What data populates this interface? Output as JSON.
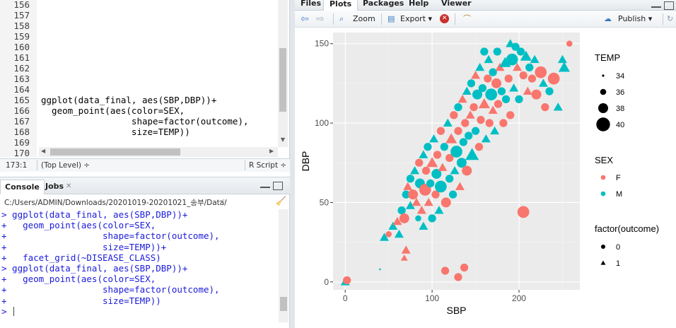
{
  "editor": {
    "line_numbers": [
      "156",
      "157",
      "158",
      "159",
      "160",
      "161",
      "162",
      "163",
      "164",
      "165",
      "166",
      "167",
      "168",
      "169",
      "170"
    ],
    "code_lines": [
      {
        "line": 165,
        "text": "ggplot(data_final, aes(SBP,DBP))+"
      },
      {
        "line": 166,
        "text": "  geom_point(aes(color=SEX,"
      },
      {
        "line": 167,
        "text": "                 shape=factor(outcome),"
      },
      {
        "line": 168,
        "text": "                 size=TEMP))"
      }
    ],
    "status": {
      "position": "173:1",
      "scope": "(Top Level) ÷",
      "filetype": "R Script ÷"
    }
  },
  "console": {
    "tabs": [
      {
        "label": "Console"
      },
      {
        "label": "Jobs"
      }
    ],
    "path": "C:/Users/ADMIN/Downloads/20201019-20201021_송부/Data/",
    "lines": [
      "> ggplot(data_final, aes(SBP,DBP))+",
      "+   geom_point(aes(color=SEX,",
      "+                  shape=factor(outcome),",
      "+                  size=TEMP))+",
      "+   facet_grid(~DISEASE_CLASS)",
      "> ggplot(data_final, aes(SBP,DBP))+",
      "+   geom_point(aes(color=SEX,",
      "+                  shape=factor(outcome),",
      "+                  size=TEMP))",
      "> "
    ]
  },
  "right_pane": {
    "tabs": [
      {
        "label": "Files"
      },
      {
        "label": "Plots"
      },
      {
        "label": "Packages"
      },
      {
        "label": "Help"
      },
      {
        "label": "Viewer"
      }
    ],
    "active_tab": "Plots",
    "toolbar": {
      "zoom": "Zoom",
      "export": "Export ▾",
      "publish": "Publish ▾"
    }
  },
  "chart_data": {
    "type": "scatter",
    "title": "",
    "xlabel": "SBP",
    "ylabel": "DBP",
    "xlim": [
      -14,
      270
    ],
    "ylim": [
      -5,
      157
    ],
    "x_ticks": [
      0,
      100,
      200
    ],
    "y_ticks": [
      0,
      50,
      100,
      150
    ],
    "panel_background": "#ebebeb",
    "grid": true,
    "series": [
      {
        "name": "F",
        "color": "#f8766d"
      },
      {
        "name": "M",
        "color": "#00bfc4"
      }
    ],
    "legend_position": "right",
    "legends": {
      "size": {
        "title": "TEMP",
        "labels": [
          "34",
          "36",
          "38",
          "40"
        ]
      },
      "color": {
        "title": "SEX",
        "labels": [
          "F",
          "M"
        ]
      },
      "shape": {
        "title": "factor(outcome)",
        "labels": [
          "0",
          "1"
        ]
      }
    },
    "points": [
      {
        "x": 0,
        "y": 0,
        "sex": "M",
        "outcome": 1,
        "temp": 37
      },
      {
        "x": 2,
        "y": 1,
        "sex": "F",
        "outcome": 0,
        "temp": 37
      },
      {
        "x": 40,
        "y": 8,
        "sex": "M",
        "outcome": 1,
        "temp": 34
      },
      {
        "x": 45,
        "y": 28,
        "sex": "M",
        "outcome": 1,
        "temp": 37
      },
      {
        "x": 50,
        "y": 30,
        "sex": "F",
        "outcome": 0,
        "temp": 36
      },
      {
        "x": 55,
        "y": 35,
        "sex": "M",
        "outcome": 1,
        "temp": 37
      },
      {
        "x": 60,
        "y": 38,
        "sex": "F",
        "outcome": 1,
        "temp": 37
      },
      {
        "x": 62,
        "y": 30,
        "sex": "M",
        "outcome": 1,
        "temp": 37
      },
      {
        "x": 65,
        "y": 45,
        "sex": "M",
        "outcome": 0,
        "temp": 37
      },
      {
        "x": 68,
        "y": 40,
        "sex": "F",
        "outcome": 0,
        "temp": 38
      },
      {
        "x": 70,
        "y": 55,
        "sex": "M",
        "outcome": 0,
        "temp": 37
      },
      {
        "x": 72,
        "y": 60,
        "sex": "F",
        "outcome": 1,
        "temp": 37
      },
      {
        "x": 70,
        "y": 20,
        "sex": "F",
        "outcome": 1,
        "temp": 37
      },
      {
        "x": 68,
        "y": 15,
        "sex": "F",
        "outcome": 1,
        "temp": 36
      },
      {
        "x": 75,
        "y": 48,
        "sex": "M",
        "outcome": 1,
        "temp": 37
      },
      {
        "x": 75,
        "y": 65,
        "sex": "M",
        "outcome": 0,
        "temp": 37
      },
      {
        "x": 78,
        "y": 55,
        "sex": "F",
        "outcome": 0,
        "temp": 38
      },
      {
        "x": 80,
        "y": 70,
        "sex": "M",
        "outcome": 1,
        "temp": 37
      },
      {
        "x": 82,
        "y": 50,
        "sex": "F",
        "outcome": 1,
        "temp": 37
      },
      {
        "x": 84,
        "y": 40,
        "sex": "M",
        "outcome": 0,
        "temp": 36
      },
      {
        "x": 85,
        "y": 75,
        "sex": "F",
        "outcome": 0,
        "temp": 37
      },
      {
        "x": 86,
        "y": 62,
        "sex": "M",
        "outcome": 0,
        "temp": 38
      },
      {
        "x": 88,
        "y": 45,
        "sex": "F",
        "outcome": 1,
        "temp": 37
      },
      {
        "x": 90,
        "y": 80,
        "sex": "M",
        "outcome": 1,
        "temp": 37
      },
      {
        "x": 90,
        "y": 35,
        "sex": "M",
        "outcome": 1,
        "temp": 37
      },
      {
        "x": 92,
        "y": 58,
        "sex": "F",
        "outcome": 0,
        "temp": 39
      },
      {
        "x": 93,
        "y": 70,
        "sex": "F",
        "outcome": 0,
        "temp": 37
      },
      {
        "x": 95,
        "y": 85,
        "sex": "M",
        "outcome": 0,
        "temp": 37
      },
      {
        "x": 96,
        "y": 50,
        "sex": "F",
        "outcome": 1,
        "temp": 37
      },
      {
        "x": 98,
        "y": 62,
        "sex": "M",
        "outcome": 0,
        "temp": 37
      },
      {
        "x": 100,
        "y": 75,
        "sex": "F",
        "outcome": 1,
        "temp": 38
      },
      {
        "x": 100,
        "y": 40,
        "sex": "M",
        "outcome": 0,
        "temp": 37
      },
      {
        "x": 102,
        "y": 90,
        "sex": "M",
        "outcome": 1,
        "temp": 37
      },
      {
        "x": 104,
        "y": 55,
        "sex": "F",
        "outcome": 0,
        "temp": 37
      },
      {
        "x": 105,
        "y": 68,
        "sex": "M",
        "outcome": 0,
        "temp": 38
      },
      {
        "x": 106,
        "y": 80,
        "sex": "F",
        "outcome": 0,
        "temp": 37
      },
      {
        "x": 108,
        "y": 45,
        "sex": "M",
        "outcome": 1,
        "temp": 37
      },
      {
        "x": 110,
        "y": 95,
        "sex": "F",
        "outcome": 0,
        "temp": 37
      },
      {
        "x": 110,
        "y": 60,
        "sex": "M",
        "outcome": 0,
        "temp": 39
      },
      {
        "x": 112,
        "y": 72,
        "sex": "F",
        "outcome": 1,
        "temp": 37
      },
      {
        "x": 114,
        "y": 85,
        "sex": "M",
        "outcome": 0,
        "temp": 37
      },
      {
        "x": 115,
        "y": 7,
        "sex": "F",
        "outcome": 0,
        "temp": 37
      },
      {
        "x": 116,
        "y": 50,
        "sex": "F",
        "outcome": 0,
        "temp": 38
      },
      {
        "x": 118,
        "y": 100,
        "sex": "M",
        "outcome": 1,
        "temp": 37
      },
      {
        "x": 120,
        "y": 65,
        "sex": "M",
        "outcome": 0,
        "temp": 37
      },
      {
        "x": 120,
        "y": 78,
        "sex": "F",
        "outcome": 0,
        "temp": 37
      },
      {
        "x": 122,
        "y": 90,
        "sex": "F",
        "outcome": 1,
        "temp": 38
      },
      {
        "x": 124,
        "y": 55,
        "sex": "M",
        "outcome": 0,
        "temp": 37
      },
      {
        "x": 125,
        "y": 105,
        "sex": "F",
        "outcome": 0,
        "temp": 37
      },
      {
        "x": 126,
        "y": 70,
        "sex": "M",
        "outcome": 1,
        "temp": 37
      },
      {
        "x": 128,
        "y": 82,
        "sex": "M",
        "outcome": 0,
        "temp": 39
      },
      {
        "x": 130,
        "y": 110,
        "sex": "M",
        "outcome": 0,
        "temp": 37
      },
      {
        "x": 130,
        "y": 95,
        "sex": "F",
        "outcome": 0,
        "temp": 37
      },
      {
        "x": 130,
        "y": 3,
        "sex": "F",
        "outcome": 0,
        "temp": 37
      },
      {
        "x": 132,
        "y": 60,
        "sex": "F",
        "outcome": 1,
        "temp": 37
      },
      {
        "x": 134,
        "y": 75,
        "sex": "M",
        "outcome": 0,
        "temp": 38
      },
      {
        "x": 135,
        "y": 115,
        "sex": "F",
        "outcome": 1,
        "temp": 37
      },
      {
        "x": 136,
        "y": 88,
        "sex": "M",
        "outcome": 0,
        "temp": 37
      },
      {
        "x": 137,
        "y": 9,
        "sex": "F",
        "outcome": 0,
        "temp": 37
      },
      {
        "x": 138,
        "y": 100,
        "sex": "F",
        "outcome": 0,
        "temp": 37
      },
      {
        "x": 140,
        "y": 120,
        "sex": "M",
        "outcome": 1,
        "temp": 37
      },
      {
        "x": 140,
        "y": 70,
        "sex": "F",
        "outcome": 0,
        "temp": 38
      },
      {
        "x": 142,
        "y": 92,
        "sex": "M",
        "outcome": 0,
        "temp": 37
      },
      {
        "x": 144,
        "y": 105,
        "sex": "F",
        "outcome": 1,
        "temp": 37
      },
      {
        "x": 145,
        "y": 125,
        "sex": "M",
        "outcome": 0,
        "temp": 37
      },
      {
        "x": 146,
        "y": 80,
        "sex": "M",
        "outcome": 1,
        "temp": 39
      },
      {
        "x": 148,
        "y": 110,
        "sex": "F",
        "outcome": 0,
        "temp": 37
      },
      {
        "x": 150,
        "y": 130,
        "sex": "F",
        "outcome": 1,
        "temp": 37
      },
      {
        "x": 150,
        "y": 95,
        "sex": "M",
        "outcome": 0,
        "temp": 37
      },
      {
        "x": 152,
        "y": 118,
        "sex": "M",
        "outcome": 0,
        "temp": 38
      },
      {
        "x": 154,
        "y": 85,
        "sex": "F",
        "outcome": 0,
        "temp": 37
      },
      {
        "x": 155,
        "y": 135,
        "sex": "M",
        "outcome": 1,
        "temp": 37
      },
      {
        "x": 156,
        "y": 102,
        "sex": "F",
        "outcome": 0,
        "temp": 37
      },
      {
        "x": 158,
        "y": 122,
        "sex": "M",
        "outcome": 0,
        "temp": 37
      },
      {
        "x": 160,
        "y": 145,
        "sex": "M",
        "outcome": 0,
        "temp": 37
      },
      {
        "x": 160,
        "y": 112,
        "sex": "F",
        "outcome": 1,
        "temp": 38
      },
      {
        "x": 162,
        "y": 90,
        "sex": "M",
        "outcome": 1,
        "temp": 37
      },
      {
        "x": 164,
        "y": 128,
        "sex": "F",
        "outcome": 0,
        "temp": 37
      },
      {
        "x": 165,
        "y": 140,
        "sex": "M",
        "outcome": 1,
        "temp": 37
      },
      {
        "x": 166,
        "y": 100,
        "sex": "F",
        "outcome": 0,
        "temp": 37
      },
      {
        "x": 168,
        "y": 118,
        "sex": "M",
        "outcome": 0,
        "temp": 39
      },
      {
        "x": 170,
        "y": 108,
        "sex": "F",
        "outcome": 1,
        "temp": 37
      },
      {
        "x": 170,
        "y": 132,
        "sex": "M",
        "outcome": 0,
        "temp": 37
      },
      {
        "x": 172,
        "y": 95,
        "sex": "M",
        "outcome": 1,
        "temp": 37
      },
      {
        "x": 174,
        "y": 125,
        "sex": "F",
        "outcome": 0,
        "temp": 38
      },
      {
        "x": 175,
        "y": 145,
        "sex": "M",
        "outcome": 0,
        "temp": 37
      },
      {
        "x": 176,
        "y": 112,
        "sex": "F",
        "outcome": 0,
        "temp": 37
      },
      {
        "x": 178,
        "y": 135,
        "sex": "F",
        "outcome": 1,
        "temp": 37
      },
      {
        "x": 180,
        "y": 120,
        "sex": "M",
        "outcome": 0,
        "temp": 37
      },
      {
        "x": 182,
        "y": 100,
        "sex": "F",
        "outcome": 0,
        "temp": 37
      },
      {
        "x": 184,
        "y": 138,
        "sex": "M",
        "outcome": 1,
        "temp": 38
      },
      {
        "x": 185,
        "y": 115,
        "sex": "M",
        "outcome": 0,
        "temp": 37
      },
      {
        "x": 188,
        "y": 128,
        "sex": "F",
        "outcome": 0,
        "temp": 37
      },
      {
        "x": 190,
        "y": 150,
        "sex": "M",
        "outcome": 1,
        "temp": 37
      },
      {
        "x": 190,
        "y": 105,
        "sex": "F",
        "outcome": 0,
        "temp": 37
      },
      {
        "x": 192,
        "y": 140,
        "sex": "M",
        "outcome": 0,
        "temp": 39
      },
      {
        "x": 194,
        "y": 122,
        "sex": "M",
        "outcome": 1,
        "temp": 37
      },
      {
        "x": 196,
        "y": 148,
        "sex": "M",
        "outcome": 0,
        "temp": 37
      },
      {
        "x": 198,
        "y": 135,
        "sex": "F",
        "outcome": 1,
        "temp": 37
      },
      {
        "x": 200,
        "y": 115,
        "sex": "M",
        "outcome": 0,
        "temp": 37
      },
      {
        "x": 202,
        "y": 145,
        "sex": "M",
        "outcome": 0,
        "temp": 37
      },
      {
        "x": 205,
        "y": 44,
        "sex": "F",
        "outcome": 0,
        "temp": 39
      },
      {
        "x": 205,
        "y": 130,
        "sex": "F",
        "outcome": 0,
        "temp": 37
      },
      {
        "x": 208,
        "y": 142,
        "sex": "M",
        "outcome": 1,
        "temp": 38
      },
      {
        "x": 210,
        "y": 120,
        "sex": "F",
        "outcome": 1,
        "temp": 37
      },
      {
        "x": 212,
        "y": 135,
        "sex": "M",
        "outcome": 0,
        "temp": 37
      },
      {
        "x": 215,
        "y": 128,
        "sex": "F",
        "outcome": 0,
        "temp": 37
      },
      {
        "x": 218,
        "y": 140,
        "sex": "M",
        "outcome": 1,
        "temp": 37
      },
      {
        "x": 220,
        "y": 118,
        "sex": "F",
        "outcome": 0,
        "temp": 38
      },
      {
        "x": 225,
        "y": 132,
        "sex": "F",
        "outcome": 0,
        "temp": 39
      },
      {
        "x": 228,
        "y": 125,
        "sex": "M",
        "outcome": 1,
        "temp": 37
      },
      {
        "x": 230,
        "y": 110,
        "sex": "F",
        "outcome": 0,
        "temp": 37
      },
      {
        "x": 235,
        "y": 120,
        "sex": "M",
        "outcome": 0,
        "temp": 37
      },
      {
        "x": 240,
        "y": 128,
        "sex": "F",
        "outcome": 0,
        "temp": 39
      },
      {
        "x": 245,
        "y": 110,
        "sex": "M",
        "outcome": 1,
        "temp": 37
      },
      {
        "x": 250,
        "y": 140,
        "sex": "M",
        "outcome": 1,
        "temp": 37
      },
      {
        "x": 252,
        "y": 135,
        "sex": "M",
        "outcome": 1,
        "temp": 38
      },
      {
        "x": 258,
        "y": 150,
        "sex": "F",
        "outcome": 0,
        "temp": 36
      }
    ]
  }
}
